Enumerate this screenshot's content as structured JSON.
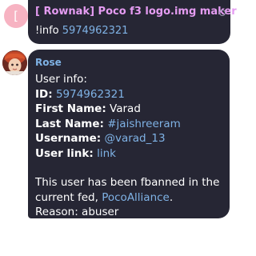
{
  "first_message": {
    "avatar_letter": "[",
    "sender": "[ Rownak] Poco f3 logo.img maker",
    "command": "!info",
    "user_id": "5974962321"
  },
  "reply": {
    "sender": "Rose",
    "heading": "User info:",
    "id_label": "ID:",
    "id_value": "5974962321",
    "first_name_label": "First Name:",
    "first_name_value": "Varad",
    "last_name_label": "Last Name:",
    "last_name_value": "#jaishreeram",
    "username_label": "Username:",
    "username_value": "@varad_13",
    "user_link_label": "User link:",
    "user_link_value": "link",
    "fban_text": "This user has been fbanned in the current fed,",
    "fed_name": "PocoAlliance",
    "fed_period": ".",
    "reason_label": "Reason:",
    "reason_value": "abuser"
  },
  "colors": {
    "bubble": "#262634",
    "sender_pink": "#e59cf2",
    "link_blue": "#7fb2e5",
    "avatar_pink": "#f7b3c2"
  }
}
